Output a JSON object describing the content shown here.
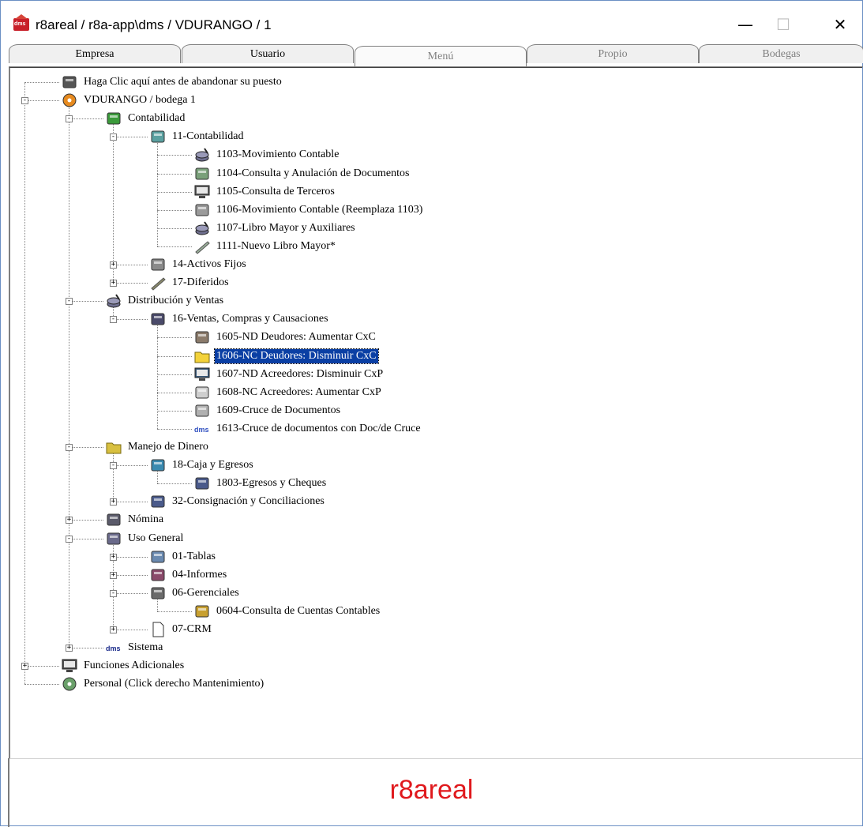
{
  "window": {
    "title": "r8areal / r8a-app\\dms / VDURANGO / 1",
    "min_symbol": "—",
    "max_symbol": "☐",
    "close_symbol": "✕"
  },
  "tabs": [
    {
      "label": "Empresa",
      "state": "normal"
    },
    {
      "label": "Usuario",
      "state": "normal"
    },
    {
      "label": "Menú",
      "state": "selected"
    },
    {
      "label": "Propio",
      "state": "disabled"
    },
    {
      "label": "Bodegas",
      "state": "disabled"
    }
  ],
  "tree": {
    "items": [
      {
        "label": "Haga Clic aquí antes de abandonar su puesto",
        "icon": "door-exit-icon"
      },
      {
        "label": "VDURANGO / bodega 1",
        "icon": "user-orbit-icon"
      },
      {
        "label": "Contabilidad",
        "icon": "accounting-cube-icon"
      },
      {
        "label": "11-Contabilidad",
        "icon": "accounting-folder-icon"
      },
      {
        "label": "1103-Movimiento Contable",
        "icon": "coins-icon"
      },
      {
        "label": "1104-Consulta y Anulación de Documentos",
        "icon": "trash-bin-icon"
      },
      {
        "label": "1105-Consulta de Terceros",
        "icon": "monitor-icon"
      },
      {
        "label": "1106-Movimiento Contable (Reemplaza 1103)",
        "icon": "ledger-icon"
      },
      {
        "label": "1107-Libro Mayor y Auxiliares",
        "icon": "coins-icon"
      },
      {
        "label": "1111-Nuevo Libro Mayor*",
        "icon": "pen-icon"
      },
      {
        "label": "14-Activos Fijos",
        "icon": "fixed-assets-icon"
      },
      {
        "label": "17-Diferidos",
        "icon": "quill-icon"
      },
      {
        "label": "Distribución y Ventas",
        "icon": "distribution-icon"
      },
      {
        "label": "16-Ventas, Compras y Causaciones",
        "icon": "sales-icon"
      },
      {
        "label": "1605-ND Deudores: Aumentar CxC",
        "icon": "debit-icon"
      },
      {
        "label": "1606-NC Deudores: Disminuir CxC",
        "icon": "folder-icon"
      },
      {
        "label": "1607-ND Acreedores: Disminuir CxP",
        "icon": "terminal-icon"
      },
      {
        "label": "1608-NC Acreedores: Aumentar CxP",
        "icon": "cloud-icon"
      },
      {
        "label": "1609-Cruce de Documentos",
        "icon": "documents-icon"
      },
      {
        "label": "1613-Cruce de documentos con Doc/de Cruce",
        "icon": "dms-logo-icon"
      },
      {
        "label": "Manejo de Dinero",
        "icon": "money-folder-icon"
      },
      {
        "label": "18-Caja y Egresos",
        "icon": "cash-icon"
      },
      {
        "label": "1803-Egresos y Cheques",
        "icon": "check-icon"
      },
      {
        "label": "32-Consignación y Conciliaciones",
        "icon": "deposit-icon"
      },
      {
        "label": "Nómina",
        "icon": "payroll-icon"
      },
      {
        "label": "Uso General",
        "icon": "general-use-icon"
      },
      {
        "label": "01-Tablas",
        "icon": "tables-icon"
      },
      {
        "label": "04-Informes",
        "icon": "reports-icon"
      },
      {
        "label": "06-Gerenciales",
        "icon": "management-icon"
      },
      {
        "label": "0604-Consulta de Cuentas Contables",
        "icon": "org-chart-icon"
      },
      {
        "label": "07-CRM",
        "icon": "blank-page-icon"
      },
      {
        "label": "Sistema",
        "icon": "dms-text-icon"
      },
      {
        "label": "Funciones Adicionales",
        "icon": "computer-icon"
      },
      {
        "label": "Personal (Click derecho Mantenimiento)",
        "icon": "cd-icon"
      }
    ],
    "selected_index": 15
  },
  "footer": {
    "brand": "r8areal",
    "brand_color": "#e0191d"
  },
  "colors": {
    "selection": "#0a3fa4",
    "window_border": "#6b8fc4"
  }
}
